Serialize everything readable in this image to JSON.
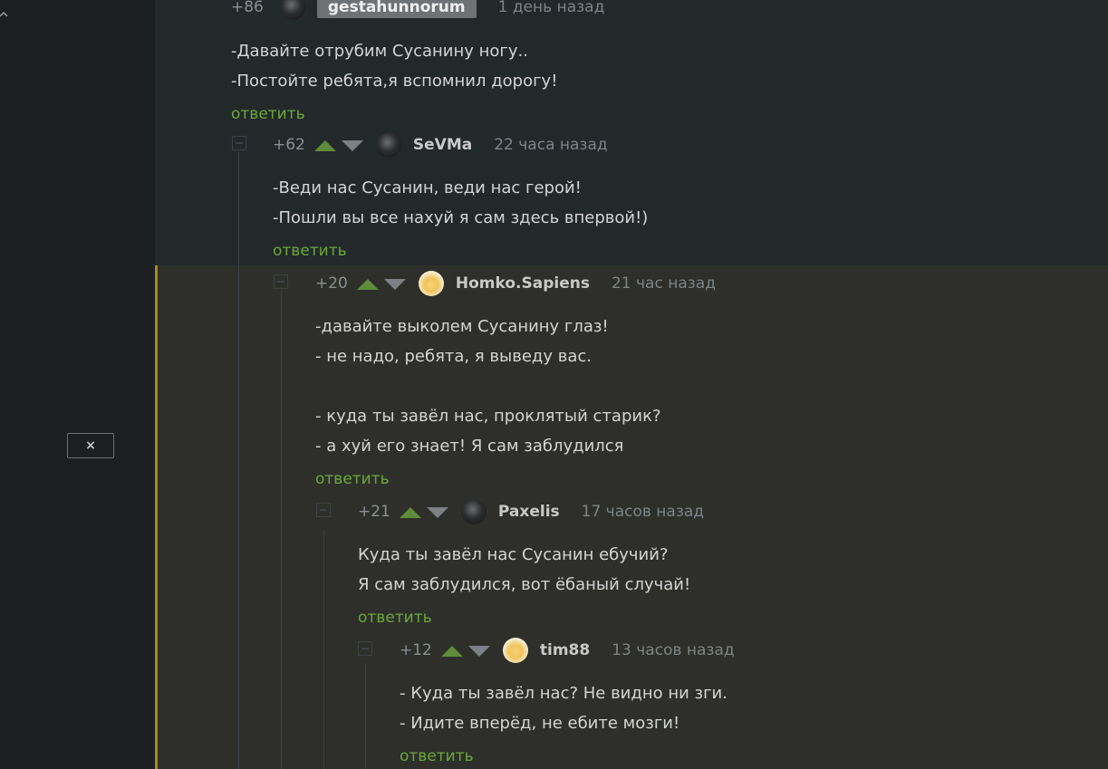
{
  "sidebar": {
    "close_label": "×"
  },
  "colors": {
    "reply": "#6aa839",
    "highlight": "#a58a24",
    "vote_up": "#5e8c3a",
    "vote_down": "#7d8185"
  },
  "comments": [
    {
      "rating": "+86",
      "username": "gestahunnorum",
      "time": "1 день назад",
      "lines": [
        "-Давайте отрубим Сусанину ногу..",
        "-Постойте ребята,я вспомнил дорогу!"
      ],
      "reply": "ответить"
    },
    {
      "rating": "+62",
      "username": "SeVMa",
      "time": "22 часа назад",
      "lines": [
        "-Веди нас Сусанин, веди нас герой!",
        "-Пошли вы все нахуй я сам здесь впервой!)"
      ],
      "reply": "ответить"
    },
    {
      "rating": "+20",
      "username": "Homko.Sapiens",
      "time": "21 час назад",
      "lines": [
        "-давайте выколем Сусанину глаз!",
        "- не надо, ребята, я выведу вас.",
        "",
        "- куда ты завёл нас, проклятый старик?",
        "- а хуй его знает! Я сам заблудился"
      ],
      "reply": "ответить"
    },
    {
      "rating": "+21",
      "username": "Paxelis",
      "time": "17 часов назад",
      "lines": [
        "Куда ты завёл нас Сусанин ебучий?",
        "Я сам заблудился, вот ёбаный случай!"
      ],
      "reply": "ответить"
    },
    {
      "rating": "+12",
      "username": "tim88",
      "time": "13 часов назад",
      "lines": [
        "- Куда ты завёл нас? Не видно ни зги.",
        "- Идите вперёд, не ебите мозги!"
      ],
      "reply": "ответить"
    }
  ]
}
